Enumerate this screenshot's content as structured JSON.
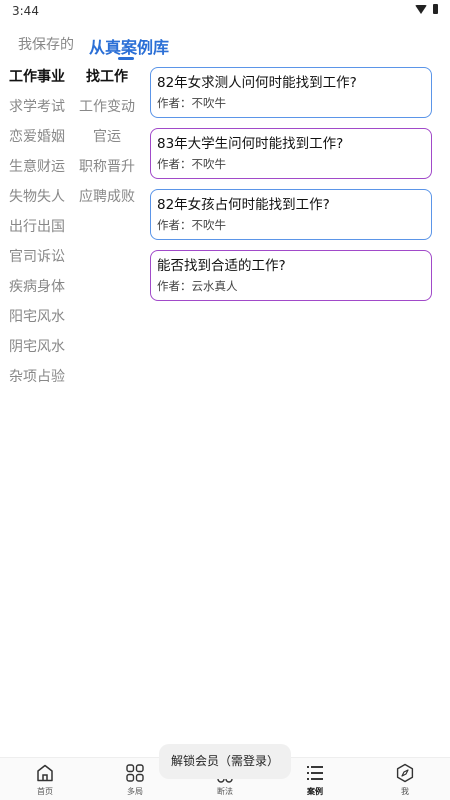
{
  "status_bar": {
    "time": "3:44"
  },
  "top_tabs": {
    "saved": "我保存的",
    "library": "从真案例库"
  },
  "categories": [
    "工作事业",
    "求学考试",
    "恋爱婚姻",
    "生意财运",
    "失物失人",
    "出行出国",
    "官司诉讼",
    "疾病身体",
    "阳宅风水",
    "阴宅风水",
    "杂项占验"
  ],
  "subcategories": [
    "找工作",
    "工作变动",
    "官运",
    "职称晋升",
    "应聘成败"
  ],
  "cases": [
    {
      "title": "82年女求测人问何时能找到工作?",
      "author": "作者：不吹牛"
    },
    {
      "title": "83年大学生问何时能找到工作?",
      "author": "作者：不吹牛"
    },
    {
      "title": "82年女孩占何时能找到工作?",
      "author": "作者：不吹牛"
    },
    {
      "title": "能否找到合适的工作?",
      "author": "作者：云水真人"
    }
  ],
  "toast": "解锁会员（需登录）",
  "bottom_nav": [
    "首页",
    "多局",
    "断法",
    "案例",
    "我"
  ],
  "colors": {
    "accent": "#2b6fd6",
    "card_border_blue": "#5b95e8",
    "card_border_purple": "#a14ac9"
  }
}
